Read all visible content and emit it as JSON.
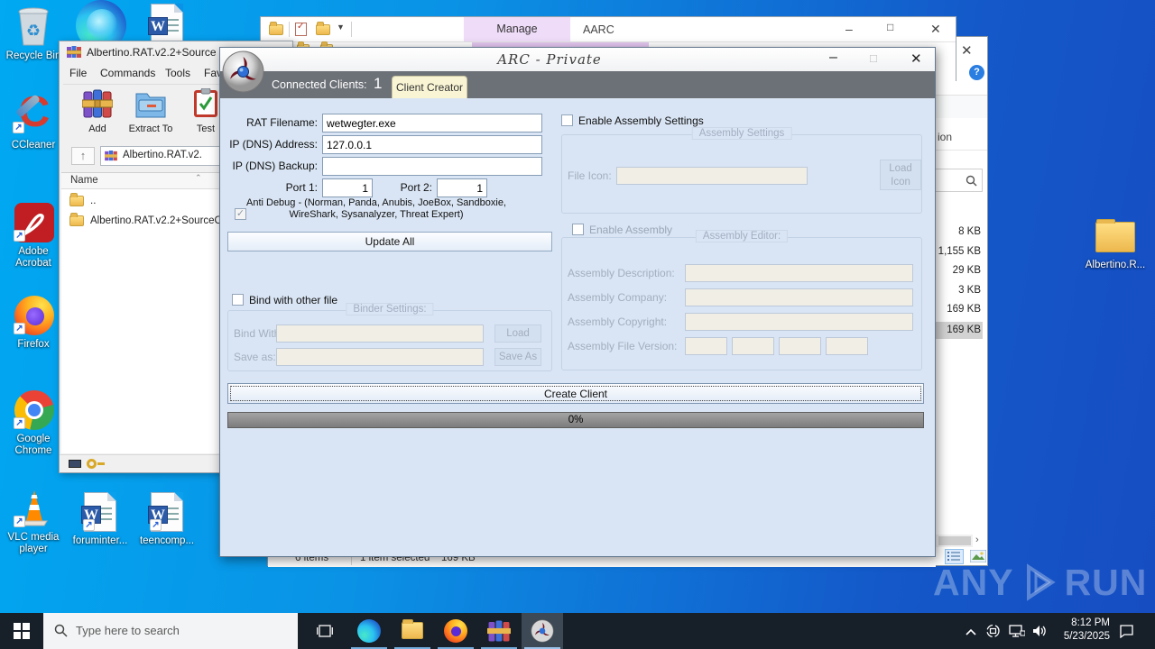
{
  "colors": {
    "desktop_left": "#00a9f2",
    "desktop_right": "#164dc2",
    "band": "#6c7077",
    "tab": "#f9f5d4",
    "body": "#d9e5f4",
    "taskbar": "#171f29",
    "selection": "#d2d2d2"
  },
  "desktop": {
    "icons": {
      "recycle": "Recycle Bin",
      "ccleaner": "CCleaner",
      "acrobat": "Adobe Acrobat",
      "firefox": "Firefox",
      "chrome": "Google Chrome",
      "vlc": "VLC media player",
      "doc1": "foruminter...",
      "doc2": "teencomp...",
      "folder": "Albertino.R..."
    },
    "watermark_left": "ANY",
    "watermark_right": "RUN"
  },
  "explorer": {
    "tab_manage": "Manage",
    "title": "AARC",
    "column_suffix": "ion",
    "sizes": [
      "8 KB",
      "1,155 KB",
      "29 KB",
      "3 KB",
      "169 KB",
      "169 KB"
    ],
    "status_items": "6 items",
    "status_selected": "1 item selected",
    "status_size": "169 KB"
  },
  "winrar": {
    "title": "Albertino.RAT.v2.2+Source",
    "menu": [
      "File",
      "Commands",
      "Tools",
      "Favorites"
    ],
    "toolbar": [
      "Add",
      "Extract To",
      "Test"
    ],
    "address": "Albertino.RAT.v2.",
    "column_name": "Name",
    "files": [
      "..",
      "Albertino.RAT.v2.2+SourceC"
    ]
  },
  "app": {
    "title": "ARC - Private",
    "connected_label": "Connected Clients:",
    "connected_count": "1",
    "tab": "Client Creator",
    "fields": {
      "rat_filename_label": "RAT Filename:",
      "rat_filename_value": "wetwegter.exe",
      "ip_label": "IP (DNS) Address:",
      "ip_value": "127.0.0.1",
      "backup_label": "IP (DNS) Backup:",
      "backup_value": "",
      "port1_label": "Port 1:",
      "port1_value": "1",
      "port2_label": "Port 2:",
      "port2_value": "1"
    },
    "antidebug_line1": "Anti Debug - (Norman, Panda, Anubis, JoeBox, Sandboxie,",
    "antidebug_line2": "WireShark, Sysanalyzer, Threat Expert)",
    "update_all": "Update All",
    "bind_checkbox": "Bind with other file",
    "binder": {
      "title": "Binder Settings:",
      "bind_with": "Bind With:",
      "load": "Load",
      "save_as_label": "Save as:",
      "save_as_btn": "Save As"
    },
    "assembly": {
      "enable_settings": "Enable Assembly Settings",
      "settings_title": "Assembly Settings",
      "file_icon": "File Icon:",
      "load_icon_1": "Load",
      "load_icon_2": "Icon",
      "enable_assembly": "Enable Assembly",
      "editor_title": "Assembly Editor:",
      "description": "Assembly Description:",
      "company": "Assembly Company:",
      "copyright": "Assembly Copyright:",
      "file_version": "Assembly File Version:"
    },
    "create_client": "Create Client",
    "progress": "0%"
  },
  "taskbar": {
    "search_placeholder": "Type here to search",
    "time": "8:12 PM",
    "date": "5/23/2025"
  }
}
